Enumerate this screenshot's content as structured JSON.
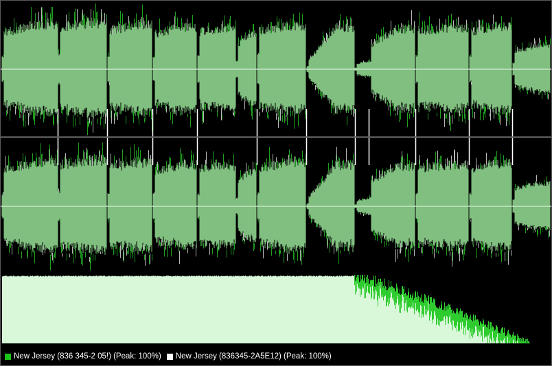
{
  "colors": {
    "background": "#000000",
    "wave_fill": "#80bf80",
    "wave_peak_green": "#1f9e1f",
    "wave_peak_gray": "#b7b7b7",
    "center_line": "#c8e6c8",
    "track_marker": "#ffffff",
    "spectrum_light": "#d9f7d9",
    "spectrum_peak": "#11c411"
  },
  "legend": {
    "items": [
      {
        "label": "New Jersey (836 345-2 05!) (Peak: 100%)",
        "swatch_color": "#19c519"
      },
      {
        "label": "New Jersey (836345-2A5E12) (Peak: 100%)",
        "swatch_color": "#ffffff"
      }
    ]
  }
}
